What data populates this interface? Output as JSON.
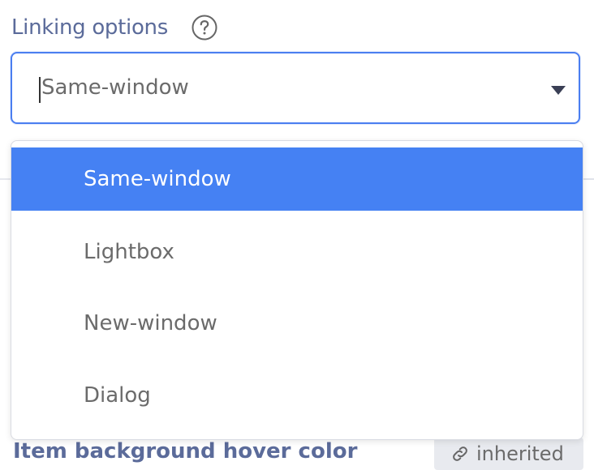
{
  "field": {
    "label": "Linking options",
    "help_icon": "question-circle-icon",
    "selected_value": "Same-window",
    "dropdown_icon": "chevron-down-icon"
  },
  "dropdown": {
    "options": [
      "Same-window",
      "Lightbox",
      "New-window",
      "Dialog"
    ],
    "selected_index": 0
  },
  "background_row": {
    "label": "Item background hover color",
    "badge_icon": "link-icon",
    "badge_text": "inherited"
  },
  "colors": {
    "accent": "#4581f3",
    "label": "#5b6b9a",
    "option_text": "#6b6b6b"
  }
}
